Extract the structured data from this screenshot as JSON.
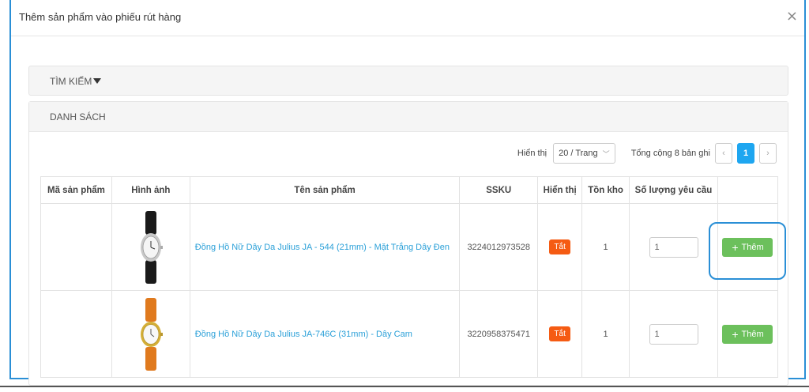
{
  "modal": {
    "title": "Thêm sản phẩm vào phiếu rút hàng",
    "close_icon": "×"
  },
  "search_panel": {
    "label": "TÌM KIẾM"
  },
  "list_panel": {
    "label": "DANH SÁCH"
  },
  "toolbar": {
    "show_label": "Hiển thị",
    "page_size": "20 / Trang",
    "total": "Tổng cộng 8 bản ghi",
    "prev": "‹",
    "current_page": "1",
    "next": "›"
  },
  "table": {
    "headers": {
      "code": "Mã sản phẩm",
      "image": "Hình ảnh",
      "name": "Tên sản phẩm",
      "ssku": "SSKU",
      "display": "Hiển thị",
      "stock": "Tồn kho",
      "qty": "Số lượng yêu cầu",
      "action": ""
    },
    "rows": [
      {
        "code": "",
        "name": "Đồng Hồ Nữ Dây Da Julius JA - 544 (21mm) - Mặt Trắng Dây Đen",
        "ssku": "3224012973528",
        "display": "Tắt",
        "stock": "1",
        "qty": "1",
        "add_label": "Thêm",
        "strap_color": "#1a1a1a",
        "case_color": "#c8c8c8"
      },
      {
        "code": "",
        "name": "Đồng Hồ Nữ Dây Da Julius JA-746C (31mm) - Dây Cam",
        "ssku": "3220958375471",
        "display": "Tắt",
        "stock": "1",
        "qty": "1",
        "add_label": "Thêm",
        "strap_color": "#e07a1e",
        "case_color": "#d4af37"
      }
    ]
  },
  "colors": {
    "accent": "#2a8fd6",
    "link": "#2ba0d8",
    "badge": "#f55b13",
    "add_button": "#6cc05c",
    "active_page": "#1ea6f0"
  }
}
